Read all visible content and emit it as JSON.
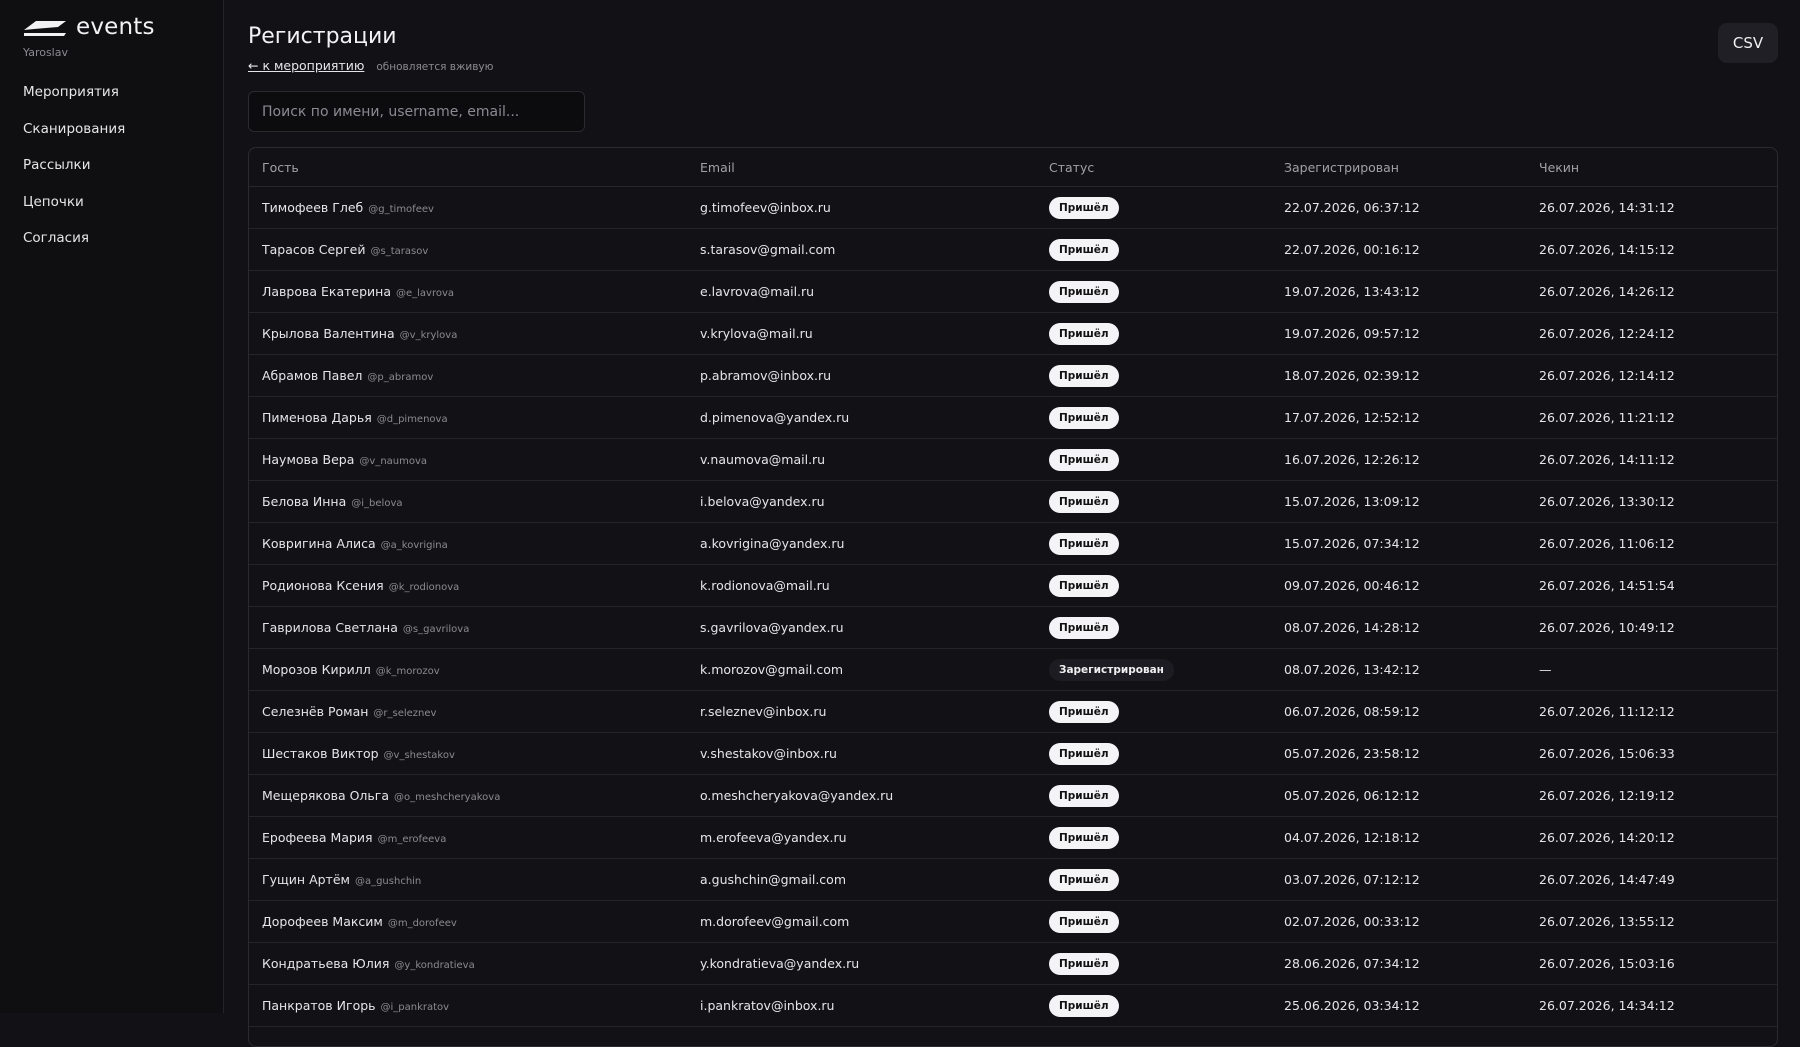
{
  "brand": {
    "name": "events",
    "org": "Yaroslav"
  },
  "nav": [
    "Мероприятия",
    "Сканирования",
    "Рассылки",
    "Цепочки",
    "Согласия"
  ],
  "page": {
    "title": "Регистрации",
    "back_link": "← к мероприятию",
    "live_note": "обновляется вживую",
    "csv_label": "CSV",
    "search_placeholder": "Поиск по имени, username, email..."
  },
  "table": {
    "columns": [
      "Гость",
      "Email",
      "Статус",
      "Зарегистрирован",
      "Чекин"
    ],
    "rows": [
      {
        "name": "Тимофеев Глеб",
        "username": "@g_timofeev",
        "email": "g.timofeev@inbox.ru",
        "status": "Пришёл",
        "registered": "22.07.2026, 06:37:12",
        "checkin": "26.07.2026, 14:31:12"
      },
      {
        "name": "Тарасов Сергей",
        "username": "@s_tarasov",
        "email": "s.tarasov@gmail.com",
        "status": "Пришёл",
        "registered": "22.07.2026, 00:16:12",
        "checkin": "26.07.2026, 14:15:12"
      },
      {
        "name": "Лаврова Екатерина",
        "username": "@e_lavrova",
        "email": "e.lavrova@mail.ru",
        "status": "Пришёл",
        "registered": "19.07.2026, 13:43:12",
        "checkin": "26.07.2026, 14:26:12"
      },
      {
        "name": "Крылова Валентина",
        "username": "@v_krylova",
        "email": "v.krylova@mail.ru",
        "status": "Пришёл",
        "registered": "19.07.2026, 09:57:12",
        "checkin": "26.07.2026, 12:24:12"
      },
      {
        "name": "Абрамов Павел",
        "username": "@p_abramov",
        "email": "p.abramov@inbox.ru",
        "status": "Пришёл",
        "registered": "18.07.2026, 02:39:12",
        "checkin": "26.07.2026, 12:14:12"
      },
      {
        "name": "Пименова Дарья",
        "username": "@d_pimenova",
        "email": "d.pimenova@yandex.ru",
        "status": "Пришёл",
        "registered": "17.07.2026, 12:52:12",
        "checkin": "26.07.2026, 11:21:12"
      },
      {
        "name": "Наумова Вера",
        "username": "@v_naumova",
        "email": "v.naumova@mail.ru",
        "status": "Пришёл",
        "registered": "16.07.2026, 12:26:12",
        "checkin": "26.07.2026, 14:11:12"
      },
      {
        "name": "Белова Инна",
        "username": "@i_belova",
        "email": "i.belova@yandex.ru",
        "status": "Пришёл",
        "registered": "15.07.2026, 13:09:12",
        "checkin": "26.07.2026, 13:30:12"
      },
      {
        "name": "Ковригина Алиса",
        "username": "@a_kovrigina",
        "email": "a.kovrigina@yandex.ru",
        "status": "Пришёл",
        "registered": "15.07.2026, 07:34:12",
        "checkin": "26.07.2026, 11:06:12"
      },
      {
        "name": "Родионова Ксения",
        "username": "@k_rodionova",
        "email": "k.rodionova@mail.ru",
        "status": "Пришёл",
        "registered": "09.07.2026, 00:46:12",
        "checkin": "26.07.2026, 14:51:54"
      },
      {
        "name": "Гаврилова Светлана",
        "username": "@s_gavrilova",
        "email": "s.gavrilova@yandex.ru",
        "status": "Пришёл",
        "registered": "08.07.2026, 14:28:12",
        "checkin": "26.07.2026, 10:49:12"
      },
      {
        "name": "Морозов Кирилл",
        "username": "@k_morozov",
        "email": "k.morozov@gmail.com",
        "status": "Зарегистрирован",
        "registered": "08.07.2026, 13:42:12",
        "checkin": "—"
      },
      {
        "name": "Селезнёв Роман",
        "username": "@r_seleznev",
        "email": "r.seleznev@inbox.ru",
        "status": "Пришёл",
        "registered": "06.07.2026, 08:59:12",
        "checkin": "26.07.2026, 11:12:12"
      },
      {
        "name": "Шестаков Виктор",
        "username": "@v_shestakov",
        "email": "v.shestakov@inbox.ru",
        "status": "Пришёл",
        "registered": "05.07.2026, 23:58:12",
        "checkin": "26.07.2026, 15:06:33"
      },
      {
        "name": "Мещерякова Ольга",
        "username": "@o_meshcheryakova",
        "email": "o.meshcheryakova@yandex.ru",
        "status": "Пришёл",
        "registered": "05.07.2026, 06:12:12",
        "checkin": "26.07.2026, 12:19:12"
      },
      {
        "name": "Ерофеева Мария",
        "username": "@m_erofeeva",
        "email": "m.erofeeva@yandex.ru",
        "status": "Пришёл",
        "registered": "04.07.2026, 12:18:12",
        "checkin": "26.07.2026, 14:20:12"
      },
      {
        "name": "Гущин Артём",
        "username": "@a_gushchin",
        "email": "a.gushchin@gmail.com",
        "status": "Пришёл",
        "registered": "03.07.2026, 07:12:12",
        "checkin": "26.07.2026, 14:47:49"
      },
      {
        "name": "Дорофеев Максим",
        "username": "@m_dorofeev",
        "email": "m.dorofeev@gmail.com",
        "status": "Пришёл",
        "registered": "02.07.2026, 00:33:12",
        "checkin": "26.07.2026, 13:55:12"
      },
      {
        "name": "Кондратьева Юлия",
        "username": "@y_kondratieva",
        "email": "y.kondratieva@yandex.ru",
        "status": "Пришёл",
        "registered": "28.06.2026, 07:34:12",
        "checkin": "26.07.2026, 15:03:16"
      },
      {
        "name": "Панкратов Игорь",
        "username": "@i_pankratov",
        "email": "i.pankratov@inbox.ru",
        "status": "Пришёл",
        "registered": "25.06.2026, 03:34:12",
        "checkin": "26.07.2026, 14:34:12"
      }
    ]
  }
}
